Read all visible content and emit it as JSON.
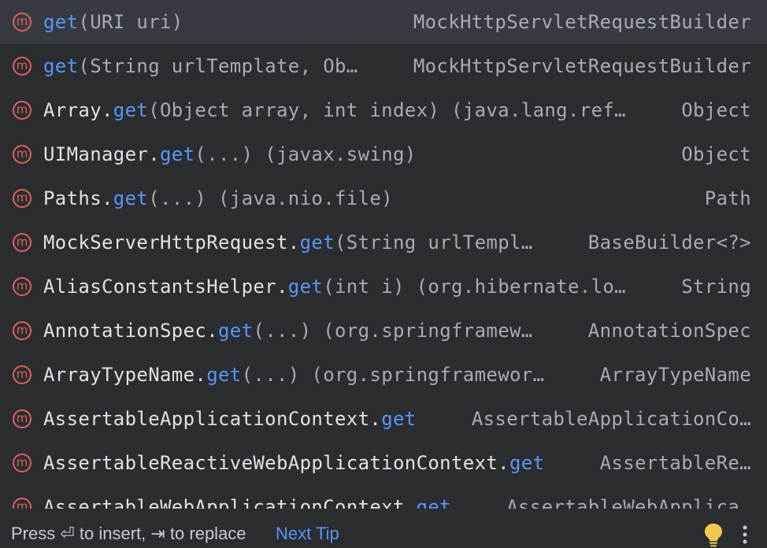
{
  "items": [
    {
      "cls": "",
      "method": "get",
      "tail": "(URI uri)",
      "type": "MockHttpServletRequestBuilder",
      "selected": true
    },
    {
      "cls": "",
      "method": "get",
      "tail": "(String urlTemplate, Ob…",
      "type": "MockHttpServletRequestBuilder"
    },
    {
      "cls": "Array.",
      "method": "get",
      "tail": "(Object array, int index) (java.lang.ref…",
      "type": "Object"
    },
    {
      "cls": "UIManager.",
      "method": "get",
      "tail": "(...) (javax.swing)",
      "type": "Object"
    },
    {
      "cls": "Paths.",
      "method": "get",
      "tail": "(...) (java.nio.file)",
      "type": "Path"
    },
    {
      "cls": "MockServerHttpRequest.",
      "method": "get",
      "tail": "(String urlTempl…",
      "type": "BaseBuilder<?>"
    },
    {
      "cls": "AliasConstantsHelper.",
      "method": "get",
      "tail": "(int i) (org.hibernate.lo…",
      "type": "String"
    },
    {
      "cls": "AnnotationSpec.",
      "method": "get",
      "tail": "(...) (org.springframew…",
      "type": "AnnotationSpec"
    },
    {
      "cls": "ArrayTypeName.",
      "method": "get",
      "tail": "(...) (org.springframewor…",
      "type": "ArrayTypeName"
    },
    {
      "cls": "AssertableApplicationContext.",
      "method": "get",
      "tail": "",
      "type": "AssertableApplicationCo…"
    },
    {
      "cls": "AssertableReactiveWebApplicationContext.",
      "method": "get",
      "tail": "",
      "type": "AssertableRe…"
    },
    {
      "cls": "AssertableWebApplicationContext.",
      "method": "get",
      "tail": "",
      "type": "AssertableWebApplica…"
    }
  ],
  "icon": {
    "name": "method-icon",
    "glyph": "m",
    "color": "#e0605e"
  },
  "footer": {
    "hint": "Press ⏎ to insert, ⇥ to replace",
    "next_tip": "Next Tip"
  },
  "colors": {
    "background": "#2b2d30",
    "selected": "#373b41",
    "method": "#5896f5",
    "class": "#dfe1e5",
    "muted": "#a8abb0"
  }
}
